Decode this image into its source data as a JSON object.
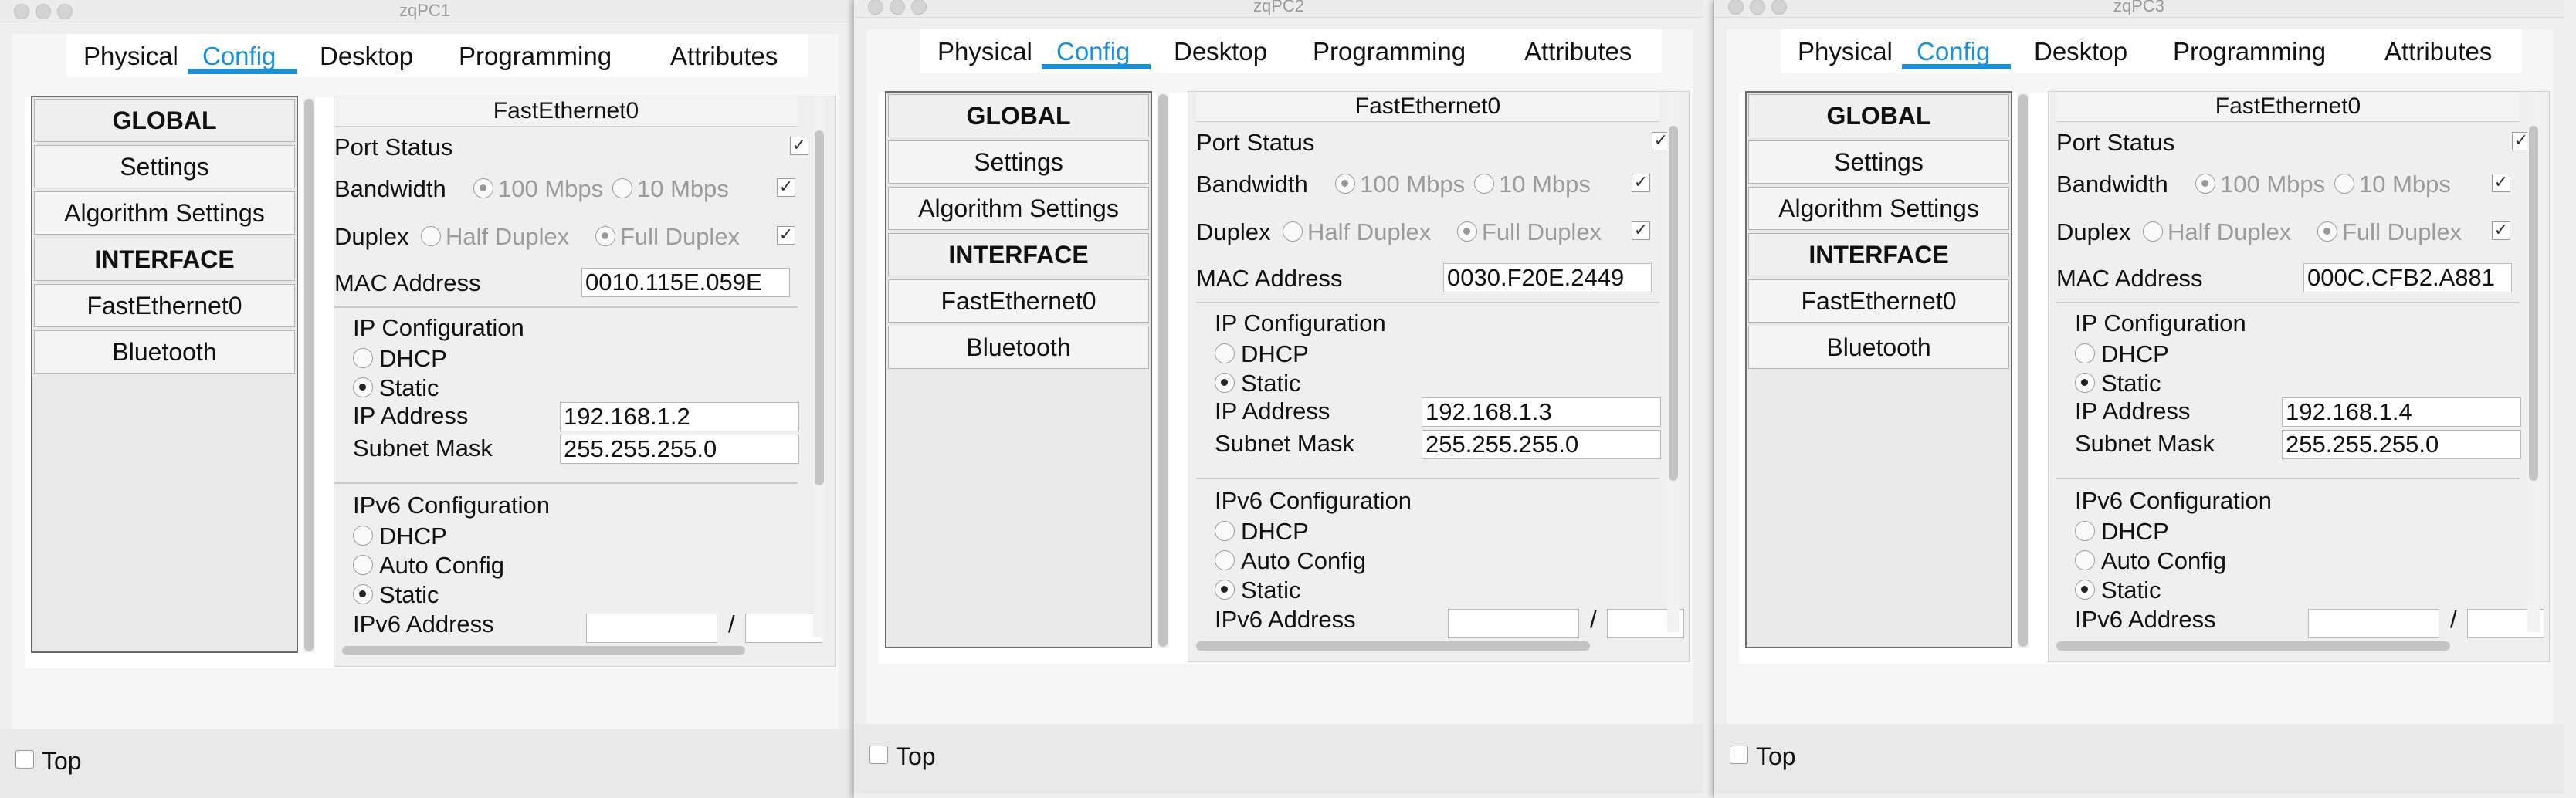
{
  "windows": [
    {
      "title": "zqPC1",
      "tabs": [
        "Physical",
        "Config",
        "Desktop",
        "Programming",
        "Attributes"
      ],
      "active_tab": "Config",
      "nav": {
        "global": "GLOBAL",
        "settings": "Settings",
        "algorithm": "Algorithm Settings",
        "interface": "INTERFACE",
        "fastethernet": "FastEthernet0",
        "bluetooth": "Bluetooth"
      },
      "panel": {
        "title": "FastEthernet0",
        "port_status": "Port Status",
        "bandwidth": "Bandwidth",
        "bw_100": "100 Mbps",
        "bw_10": "10 Mbps",
        "duplex": "Duplex",
        "half_duplex": "Half Duplex",
        "full_duplex": "Full Duplex",
        "mac_label": "MAC Address",
        "mac": "0010.115E.059E",
        "ip_config": "IP Configuration",
        "dhcp": "DHCP",
        "static": "Static",
        "ip_label": "IP Address",
        "ip": "192.168.1.2",
        "mask_label": "Subnet Mask",
        "mask": "255.255.255.0",
        "ipv6_config": "IPv6 Configuration",
        "auto_config": "Auto Config",
        "ipv6_label": "IPv6 Address",
        "slash": "/"
      },
      "top_checkbox": "Top"
    },
    {
      "title": "zqPC2",
      "tabs": [
        "Physical",
        "Config",
        "Desktop",
        "Programming",
        "Attributes"
      ],
      "active_tab": "Config",
      "nav": {
        "global": "GLOBAL",
        "settings": "Settings",
        "algorithm": "Algorithm Settings",
        "interface": "INTERFACE",
        "fastethernet": "FastEthernet0",
        "bluetooth": "Bluetooth"
      },
      "panel": {
        "title": "FastEthernet0",
        "port_status": "Port Status",
        "bandwidth": "Bandwidth",
        "bw_100": "100 Mbps",
        "bw_10": "10 Mbps",
        "duplex": "Duplex",
        "half_duplex": "Half Duplex",
        "full_duplex": "Full Duplex",
        "mac_label": "MAC Address",
        "mac": "0030.F20E.2449",
        "ip_config": "IP Configuration",
        "dhcp": "DHCP",
        "static": "Static",
        "ip_label": "IP Address",
        "ip": "192.168.1.3",
        "mask_label": "Subnet Mask",
        "mask": "255.255.255.0",
        "ipv6_config": "IPv6 Configuration",
        "auto_config": "Auto Config",
        "ipv6_label": "IPv6 Address",
        "slash": "/"
      },
      "top_checkbox": "Top"
    },
    {
      "title": "zqPC3",
      "tabs": [
        "Physical",
        "Config",
        "Desktop",
        "Programming",
        "Attributes"
      ],
      "active_tab": "Config",
      "nav": {
        "global": "GLOBAL",
        "settings": "Settings",
        "algorithm": "Algorithm Settings",
        "interface": "INTERFACE",
        "fastethernet": "FastEthernet0",
        "bluetooth": "Bluetooth"
      },
      "panel": {
        "title": "FastEthernet0",
        "port_status": "Port Status",
        "bandwidth": "Bandwidth",
        "bw_100": "100 Mbps",
        "bw_10": "10 Mbps",
        "duplex": "Duplex",
        "half_duplex": "Half Duplex",
        "full_duplex": "Full Duplex",
        "mac_label": "MAC Address",
        "mac": "000C.CFB2.A881",
        "ip_config": "IP Configuration",
        "dhcp": "DHCP",
        "static": "Static",
        "ip_label": "IP Address",
        "ip": "192.168.1.4",
        "mask_label": "Subnet Mask",
        "mask": "255.255.255.0",
        "ipv6_config": "IPv6 Configuration",
        "auto_config": "Auto Config",
        "ipv6_label": "IPv6 Address",
        "slash": "/"
      },
      "top_checkbox": "Top"
    }
  ]
}
